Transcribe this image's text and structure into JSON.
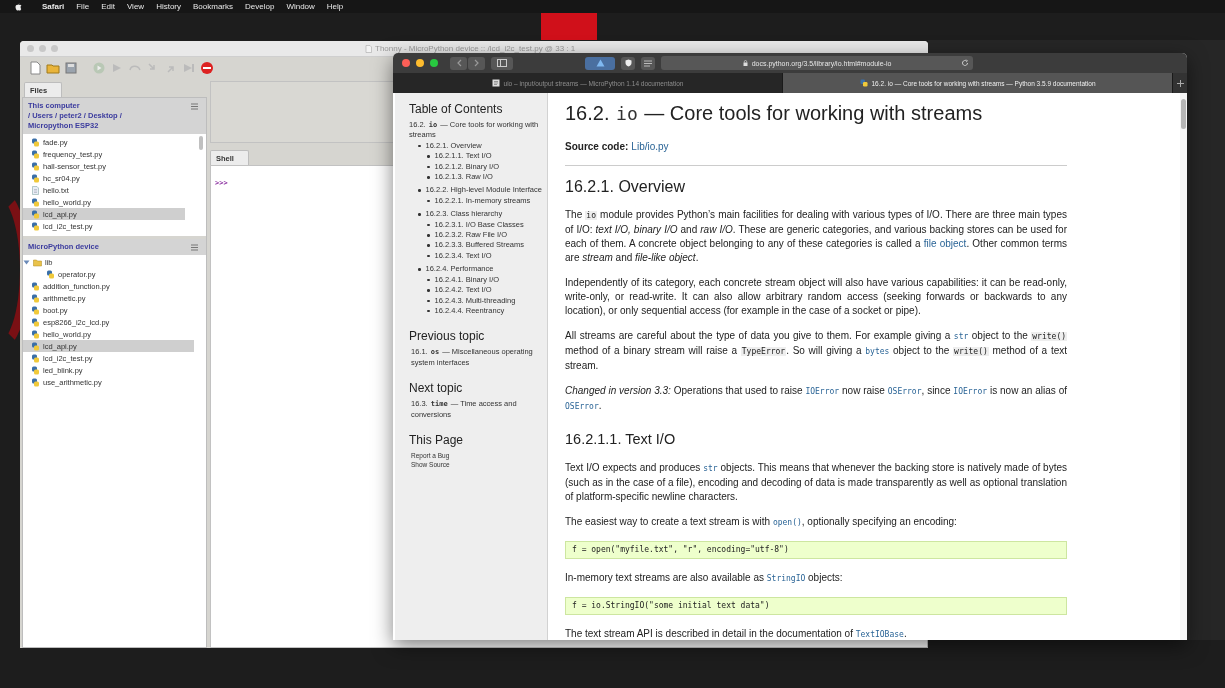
{
  "menu_bar": {
    "app": "Safari",
    "items": [
      "File",
      "Edit",
      "View",
      "History",
      "Bookmarks",
      "Develop",
      "Window",
      "Help"
    ]
  },
  "thonny": {
    "title": "Thonny - MicroPython device :: /lcd_i2c_test.py @ 33 : 1",
    "files_tab": "Files",
    "computer_panel": {
      "path": "This computer\n/ Users / peter2 / Desktop /\nMicropython ESP32",
      "items": [
        {
          "name": "fade.py",
          "kind": "python",
          "selected": false
        },
        {
          "name": "frequency_test.py",
          "kind": "python",
          "selected": false
        },
        {
          "name": "hall-sensor_test.py",
          "kind": "python",
          "selected": false
        },
        {
          "name": "hc_sr04.py",
          "kind": "python",
          "selected": false
        },
        {
          "name": "hello.txt",
          "kind": "text",
          "selected": false
        },
        {
          "name": "hello_world.py",
          "kind": "python",
          "selected": false
        },
        {
          "name": "lcd_api.py",
          "kind": "python",
          "selected": true
        },
        {
          "name": "lcd_i2c_test.py",
          "kind": "python",
          "selected": false
        }
      ]
    },
    "device_panel": {
      "title": "MicroPython device",
      "items": [
        {
          "name": "lib",
          "kind": "folder",
          "expanded": true,
          "selected": false,
          "children": [
            {
              "name": "operator.py",
              "kind": "python",
              "selected": false
            }
          ]
        },
        {
          "name": "addition_function.py",
          "kind": "python",
          "selected": false
        },
        {
          "name": "arithmetic.py",
          "kind": "python",
          "selected": false
        },
        {
          "name": "boot.py",
          "kind": "python",
          "selected": false
        },
        {
          "name": "esp8266_i2c_lcd.py",
          "kind": "python",
          "selected": false
        },
        {
          "name": "hello_world.py",
          "kind": "python",
          "selected": false
        },
        {
          "name": "lcd_api.py",
          "kind": "python",
          "selected": true
        },
        {
          "name": "lcd_i2c_test.py",
          "kind": "python",
          "selected": false
        },
        {
          "name": "led_blink.py",
          "kind": "python",
          "selected": false
        },
        {
          "name": "use_arithmetic.py",
          "kind": "python",
          "selected": false
        }
      ]
    },
    "shell": {
      "tab": "Shell",
      "prompt": ">>>"
    }
  },
  "safari": {
    "url": "docs.python.org/3.5/library/io.html#module-io",
    "tabs": [
      {
        "title": "uio – input/output streams — MicroPython 1.14 documentation",
        "selected": false
      },
      {
        "title": "16.2. io — Core tools for working with streams — Python 3.5.9 documentation",
        "selected": true
      }
    ],
    "sidebar": {
      "toc_title": "Table of Contents",
      "toc": [
        {
          "parts": [
            {
              "kind": "text",
              "text": "16.2. "
            },
            {
              "kind": "code",
              "text": "io"
            },
            {
              "kind": "text",
              "text": " — Core tools for working with streams"
            }
          ],
          "children": [
            {
              "text": "16.2.1. Overview",
              "children": [
                {
                  "text": "16.2.1.1. Text I/O"
                },
                {
                  "text": "16.2.1.2. Binary I/O"
                },
                {
                  "text": "16.2.1.3. Raw I/O"
                }
              ]
            },
            {
              "text": "16.2.2. High-level Module Interface",
              "children": [
                {
                  "text": "16.2.2.1. In-memory streams"
                }
              ]
            },
            {
              "text": "16.2.3. Class hierarchy",
              "children": [
                {
                  "text": "16.2.3.1. I/O Base Classes"
                },
                {
                  "text": "16.2.3.2. Raw File I/O"
                },
                {
                  "text": "16.2.3.3. Buffered Streams"
                },
                {
                  "text": "16.2.3.4. Text I/O"
                }
              ]
            },
            {
              "text": "16.2.4. Performance",
              "children": [
                {
                  "text": "16.2.4.1. Binary I/O"
                },
                {
                  "text": "16.2.4.2. Text I/O"
                },
                {
                  "text": "16.2.4.3. Multi-threading"
                },
                {
                  "text": "16.2.4.4. Reentrancy"
                }
              ]
            }
          ]
        }
      ],
      "previous": {
        "title": "Previous topic",
        "parts": [
          {
            "kind": "text",
            "text": "16.1. "
          },
          {
            "kind": "code",
            "text": "os"
          },
          {
            "kind": "text",
            "text": " — Miscellaneous operating system interfaces"
          }
        ]
      },
      "next": {
        "title": "Next topic",
        "parts": [
          {
            "kind": "text",
            "text": "16.3. "
          },
          {
            "kind": "code",
            "text": "time"
          },
          {
            "kind": "text",
            "text": " — Time access and conversions"
          }
        ]
      },
      "this_page": {
        "title": "This Page",
        "links": [
          "Report a Bug",
          "Show Source"
        ]
      }
    },
    "doc": [
      {
        "kind": "h1",
        "parts": [
          {
            "kind": "text",
            "text": "16.2. "
          },
          {
            "kind": "code",
            "text": "io"
          },
          {
            "kind": "text",
            "text": " — Core tools for working with streams"
          }
        ]
      },
      {
        "kind": "p",
        "parts": [
          {
            "kind": "strong",
            "text": "Source code:"
          },
          {
            "kind": "link",
            "text": "Lib/io.py"
          }
        ]
      },
      {
        "kind": "rule"
      },
      {
        "kind": "h2",
        "parts": [
          {
            "kind": "text",
            "text": "16.2.1. Overview"
          }
        ]
      },
      {
        "kind": "p",
        "parts": [
          {
            "kind": "text",
            "text": "The "
          },
          {
            "kind": "code",
            "text": "io"
          },
          {
            "kind": "text",
            "text": " module provides Python’s main facilities for dealing with various types of I/O. There are three main types of I/O: "
          },
          {
            "kind": "em",
            "text": "text I/O, binary I/O"
          },
          {
            "kind": "text",
            "text": " and "
          },
          {
            "kind": "em",
            "text": "raw I/O"
          },
          {
            "kind": "text",
            "text": ". These are generic categories, and various backing stores can be used for each of them. A concrete object belonging to any of these categories is called a "
          },
          {
            "kind": "link",
            "text": "file object"
          },
          {
            "kind": "text",
            "text": ". Other common terms are "
          },
          {
            "kind": "em",
            "text": "stream"
          },
          {
            "kind": "text",
            "text": " and "
          },
          {
            "kind": "em",
            "text": "file-like object"
          },
          {
            "kind": "text",
            "text": "."
          }
        ]
      },
      {
        "kind": "p",
        "parts": [
          {
            "kind": "text",
            "text": "Independently of its category, each concrete stream object will also have various capabilities: it can be read-only, write-only, or read-write. It can also allow arbitrary random access (seeking forwards or backwards to any location), or only sequential access (for example in the case of a socket or pipe)."
          }
        ]
      },
      {
        "kind": "p",
        "parts": [
          {
            "kind": "text",
            "text": "All streams are careful about the type of data you give to them. For example giving a "
          },
          {
            "kind": "code-link",
            "text": "str"
          },
          {
            "kind": "text",
            "text": " object to the "
          },
          {
            "kind": "code",
            "text": "write()"
          },
          {
            "kind": "text",
            "text": " method of a binary stream will raise a "
          },
          {
            "kind": "code",
            "text": "TypeError"
          },
          {
            "kind": "text",
            "text": ". So will giving a "
          },
          {
            "kind": "code-link",
            "text": "bytes"
          },
          {
            "kind": "text",
            "text": " object to the "
          },
          {
            "kind": "code",
            "text": "write()"
          },
          {
            "kind": "text",
            "text": " method of a text stream."
          }
        ]
      },
      {
        "kind": "p",
        "parts": [
          {
            "kind": "em",
            "text": "Changed in version 3.3:"
          },
          {
            "kind": "text",
            "text": " Operations that used to raise "
          },
          {
            "kind": "code-link",
            "text": "IOError"
          },
          {
            "kind": "text",
            "text": " now raise "
          },
          {
            "kind": "code-link",
            "text": "OSError"
          },
          {
            "kind": "text",
            "text": ", since "
          },
          {
            "kind": "code-link",
            "text": "IOError"
          },
          {
            "kind": "text",
            "text": " is now an alias of "
          },
          {
            "kind": "code-link",
            "text": "OSError"
          },
          {
            "kind": "text",
            "text": "."
          }
        ]
      },
      {
        "kind": "h3",
        "parts": [
          {
            "kind": "text",
            "text": "16.2.1.1. Text I/O"
          }
        ]
      },
      {
        "kind": "p",
        "parts": [
          {
            "kind": "text",
            "text": "Text I/O expects and produces "
          },
          {
            "kind": "code-link",
            "text": "str"
          },
          {
            "kind": "text",
            "text": " objects. This means that whenever the backing store is natively made of bytes (such as in the case of a file), encoding and decoding of data is made transparently as well as optional translation of platform-specific newline characters."
          }
        ]
      },
      {
        "kind": "p",
        "parts": [
          {
            "kind": "text",
            "text": "The easiest way to create a text stream is with "
          },
          {
            "kind": "code-link",
            "text": "open()"
          },
          {
            "kind": "text",
            "text": ", optionally specifying an encoding:"
          }
        ]
      },
      {
        "kind": "code",
        "text": "f = open(\"myfile.txt\", \"r\", encoding=\"utf-8\")"
      },
      {
        "kind": "p",
        "parts": [
          {
            "kind": "text",
            "text": "In-memory text streams are also available as "
          },
          {
            "kind": "code-link",
            "text": "StringIO"
          },
          {
            "kind": "text",
            "text": " objects:"
          }
        ]
      },
      {
        "kind": "code",
        "text": "f = io.StringIO(\"some initial text data\")"
      },
      {
        "kind": "p",
        "parts": [
          {
            "kind": "text",
            "text": "The text stream API is described in detail in the documentation of "
          },
          {
            "kind": "code-link",
            "text": "TextIOBase"
          },
          {
            "kind": "text",
            "text": "."
          }
        ]
      }
    ]
  }
}
